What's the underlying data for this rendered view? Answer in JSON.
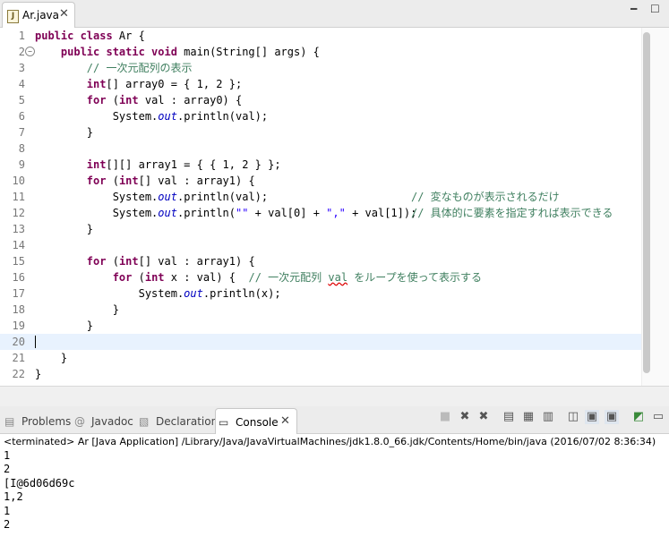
{
  "editor_tab": {
    "label": "Ar.java"
  },
  "code_lines": [
    {
      "num": "1"
    },
    {
      "num": "2"
    },
    {
      "num": "3"
    },
    {
      "num": "4"
    },
    {
      "num": "5"
    },
    {
      "num": "6"
    },
    {
      "num": "7"
    },
    {
      "num": "8"
    },
    {
      "num": "9"
    },
    {
      "num": "10"
    },
    {
      "num": "11"
    },
    {
      "num": "12"
    },
    {
      "num": "13"
    },
    {
      "num": "14"
    },
    {
      "num": "15"
    },
    {
      "num": "16"
    },
    {
      "num": "17"
    },
    {
      "num": "18"
    },
    {
      "num": "19"
    },
    {
      "num": "20"
    },
    {
      "num": "21"
    },
    {
      "num": "22"
    }
  ],
  "code": {
    "l1_kw": "public class",
    "l1_rest": " Ar {",
    "l2_kw": "public static void",
    "l2_rest": " main(String[] args) {",
    "l3_cm": "// 一次元配列の表示",
    "l4_kw": "int",
    "l4_rest": "[] array0 = { 1, 2 };",
    "l5_kw": "for",
    "l5_a": " (",
    "l5_kw2": "int",
    "l5_rest": " val : array0) {",
    "l6_a": "System.",
    "l6_fd": "out",
    "l6_rest": ".println(val);",
    "l7": "}",
    "l9_kw": "int",
    "l9_rest": "[][] array1 = { { 1, 2 } };",
    "l10_kw": "for",
    "l10_a": " (",
    "l10_kw2": "int",
    "l10_rest": "[] val : array1) {",
    "l11_a": "System.",
    "l11_fd": "out",
    "l11_rest": ".println(val);",
    "l11_cm": "// 変なものが表示されるだけ",
    "l12_a": "System.",
    "l12_fd": "out",
    "l12_b": ".println(",
    "l12_s1": "\"\"",
    "l12_c": " + val[0] + ",
    "l12_s2": "\",\"",
    "l12_d": " + val[1]);",
    "l12_cm": "// 具体的に要素を指定すれば表示できる",
    "l13": "}",
    "l15_kw": "for",
    "l15_a": " (",
    "l15_kw2": "int",
    "l15_rest": "[] val : array1) {",
    "l16_kw": "for",
    "l16_a": " (",
    "l16_kw2": "int",
    "l16_rest": " x : val) {",
    "l16_cm1": "// 一次元配列 ",
    "l16_sq": "val",
    "l16_cm2": " をループを使って表示する",
    "l17_a": "System.",
    "l17_fd": "out",
    "l17_rest": ".println(x);",
    "l18": "}",
    "l19": "}",
    "l21": "}",
    "l22": "}"
  },
  "views": {
    "problems": "Problems",
    "javadoc": "Javadoc",
    "declaration": "Declaration",
    "console": "Console"
  },
  "console": {
    "terminated": "<terminated> Ar [Java Application] /Library/Java/JavaVirtualMachines/jdk1.8.0_66.jdk/Contents/Home/bin/java (2016/07/02 8:36:34)",
    "output": [
      "1",
      "2",
      "[I@6d06d69c",
      "1,2",
      "1",
      "2"
    ]
  }
}
